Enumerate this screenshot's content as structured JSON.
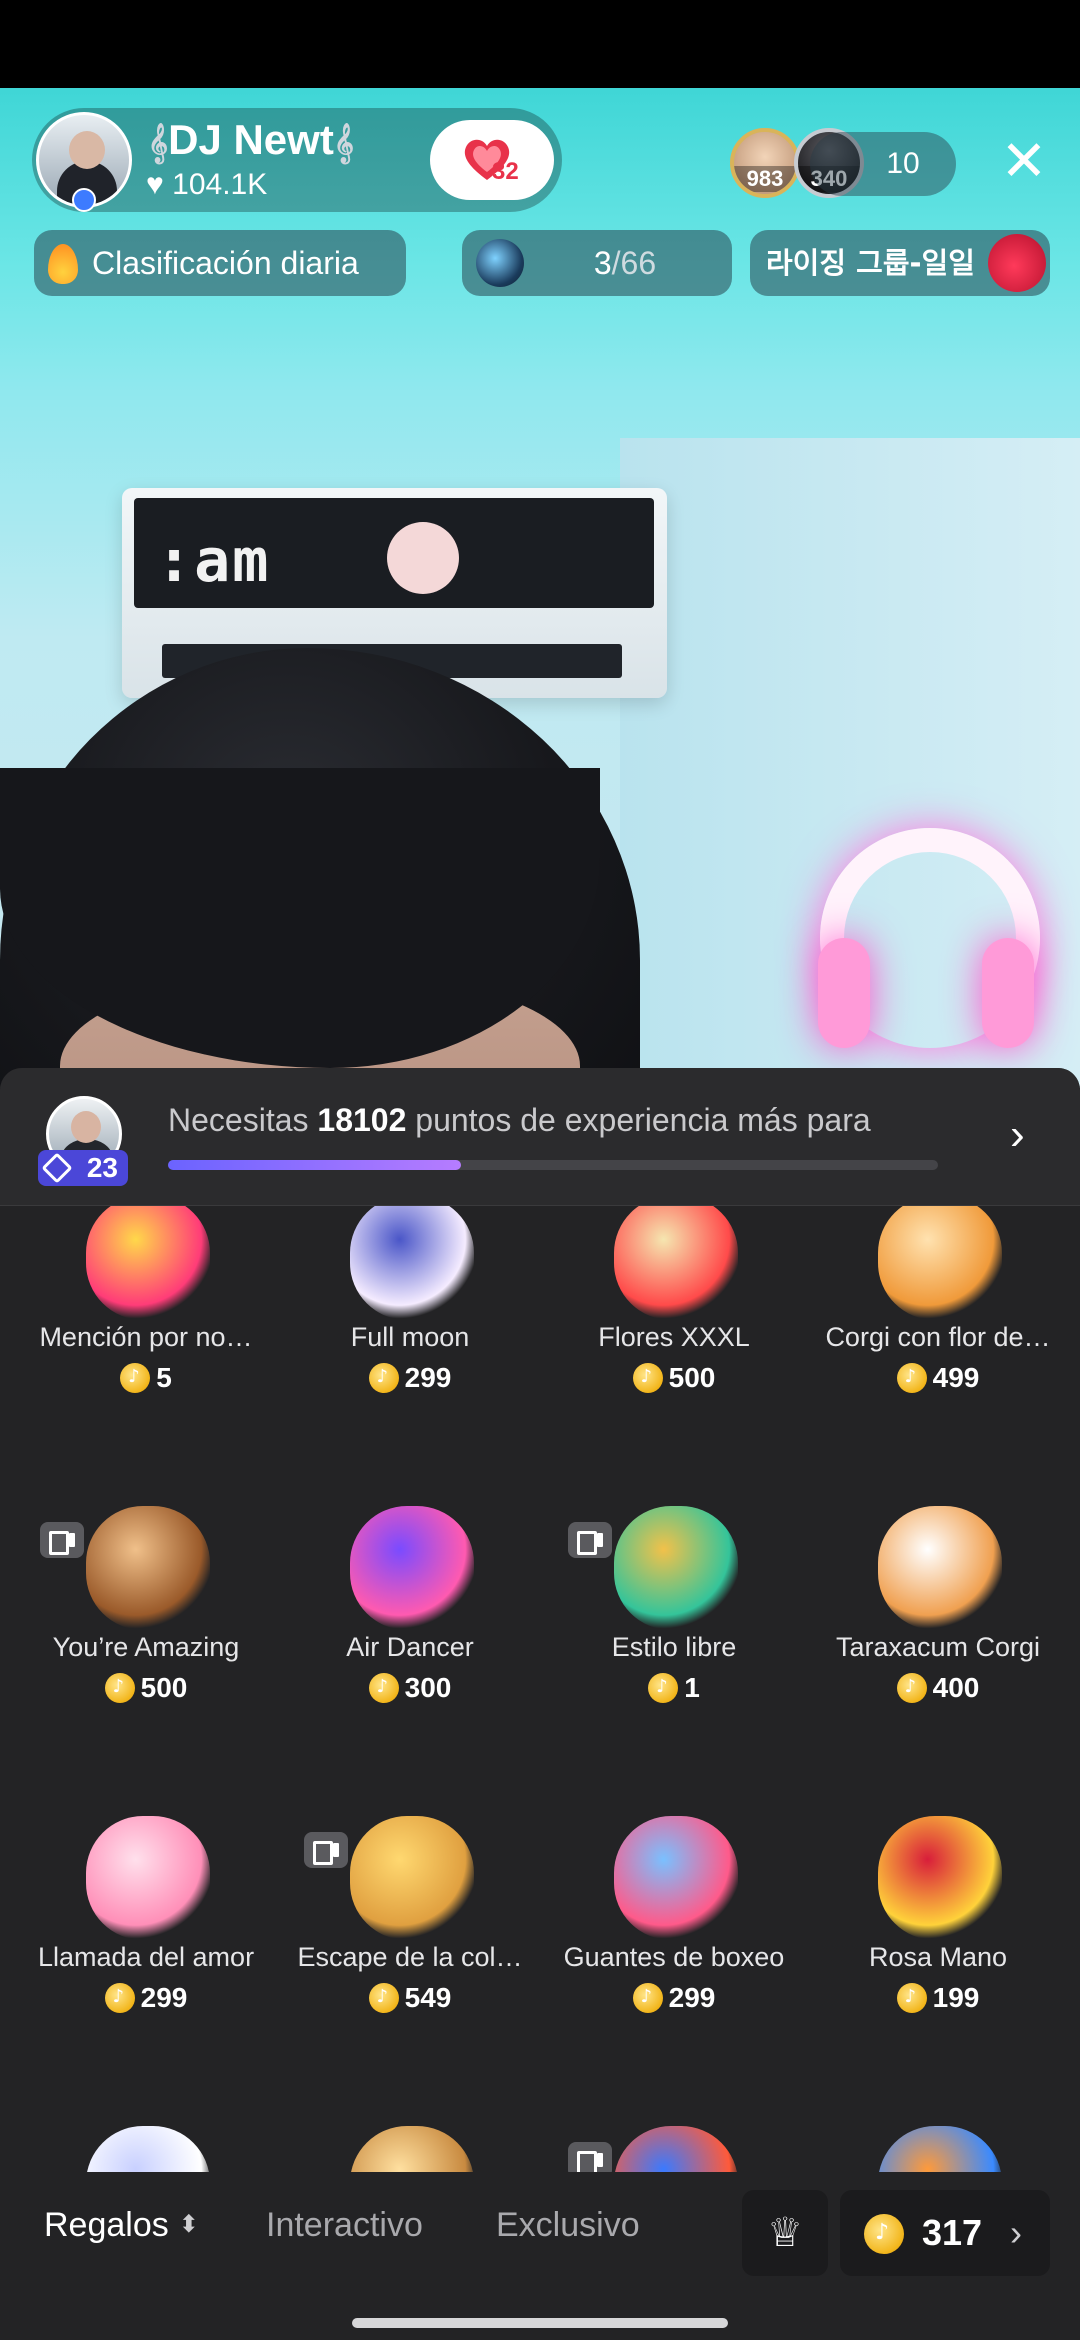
{
  "host": {
    "name": "DJ Newt",
    "likes": "104.1K",
    "follow_count": "32"
  },
  "viewers": [
    {
      "count": "983"
    },
    {
      "count": "340"
    }
  ],
  "viewer_total": "10",
  "close_glyph": "✕",
  "chips": {
    "rank_label": "Clasificación diaria",
    "match_current": "3",
    "match_total": "/66",
    "group_label": "라이징 그룹-일일"
  },
  "level": {
    "badge": "23",
    "text_prefix": "Necesitas ",
    "points": "18102",
    "text_suffix": " puntos de experiencia más para",
    "progress": 0.38
  },
  "gifts": [
    {
      "name": "Mención por no…",
      "price": "5",
      "icon": "mention-icon"
    },
    {
      "name": "Full moon",
      "price": "299",
      "icon": "moon-icon"
    },
    {
      "name": "Flores XXXL",
      "price": "500",
      "icon": "flowers-icon"
    },
    {
      "name": "Corgi con flor de…",
      "price": "499",
      "icon": "corgi-icon"
    },
    {
      "name": "You’re Amazing",
      "price": "500",
      "icon": "bear-icon",
      "video": true
    },
    {
      "name": "Air Dancer",
      "price": "300",
      "icon": "air-dancer-icon"
    },
    {
      "name": "Estilo libre",
      "price": "1",
      "icon": "keyboard-icon",
      "video": true
    },
    {
      "name": "Taraxacum Corgi",
      "price": "400",
      "icon": "corgi-dandelion-icon"
    },
    {
      "name": "Llamada del amor",
      "price": "299",
      "icon": "phone-icon"
    },
    {
      "name": "Escape de la col…",
      "price": "549",
      "icon": "beehive-icon",
      "video": true
    },
    {
      "name": "Guantes de boxeo",
      "price": "299",
      "icon": "boxing-gloves-icon"
    },
    {
      "name": "Rosa Mano",
      "price": "199",
      "icon": "rose-hand-icon"
    },
    {
      "name": "",
      "price": "",
      "icon": "swan-icon"
    },
    {
      "name": "",
      "price": "",
      "icon": "mushroom-icon"
    },
    {
      "name": "",
      "price": "",
      "icon": "jester-icon",
      "video": true
    },
    {
      "name": "",
      "price": "",
      "icon": "coral-icon"
    }
  ],
  "tabs": [
    "Regalos",
    "Interactivo",
    "Exclusivo"
  ],
  "balance": "317",
  "colors": {
    "accent": "#6b63ff",
    "coin": "#f2b51a",
    "sheet_bg": "#232325",
    "follow_heart": "#e8324a"
  }
}
